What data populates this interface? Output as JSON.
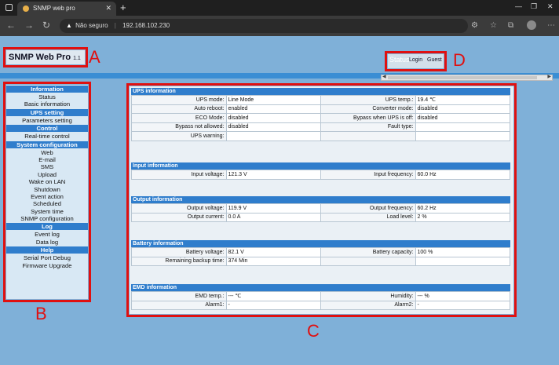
{
  "browser": {
    "tab_title": "SNMP web pro",
    "security_label": "Não seguro",
    "url": "192.168.102.230"
  },
  "brand": {
    "name": "SNMP Web Pro",
    "version": "1.1"
  },
  "status_area": {
    "status": "Status",
    "login": "Login",
    "guest": "Guest"
  },
  "annotations": {
    "a": "A",
    "b": "B",
    "c": "C",
    "d": "D"
  },
  "sidebar": [
    {
      "header": "Information",
      "items": [
        "Status",
        "Basic information"
      ]
    },
    {
      "header": "UPS setting",
      "items": [
        "Parameters setting"
      ]
    },
    {
      "header": "Control",
      "items": [
        "Real-time control"
      ]
    },
    {
      "header": "System configuration",
      "items": [
        "Web",
        "E-mail",
        "SMS",
        "Upload",
        "Wake on LAN",
        "Shutdown",
        "Event action",
        "Scheduled",
        "System time",
        "SNMP configuration"
      ]
    },
    {
      "header": "Log",
      "items": [
        "Event log",
        "Data log"
      ]
    },
    {
      "header": "Help",
      "items": [
        "Serial Port Debug",
        "Firmware Upgrade"
      ]
    }
  ],
  "sections": [
    {
      "title": "UPS information",
      "rows": [
        [
          "UPS mode:",
          "Line Mode",
          "UPS temp.:",
          "19.4 ℃"
        ],
        [
          "Auto reboot:",
          "enabled",
          "Converter mode:",
          "disabled"
        ],
        [
          "ECO Mode:",
          "disabled",
          "Bypass when UPS is off:",
          "disabled"
        ],
        [
          "Bypass not allowed:",
          "disabled",
          "Fault type:",
          ""
        ],
        [
          "UPS warning:",
          "",
          "",
          ""
        ]
      ]
    },
    {
      "title": "Input information",
      "rows": [
        [
          "Input voltage:",
          "121.3 V",
          "Input frequency:",
          "60.0 Hz"
        ]
      ]
    },
    {
      "title": "Output information",
      "rows": [
        [
          "Output voltage:",
          "119.9 V",
          "Output frequency:",
          "60.2 Hz"
        ],
        [
          "Output current:",
          "0.0 A",
          "Load level:",
          "2 %"
        ]
      ]
    },
    {
      "title": "Battery information",
      "rows": [
        [
          "Battery voltage:",
          "82.1 V",
          "Battery capacity:",
          "100 %"
        ],
        [
          "Remaining backup time:",
          "374 Min",
          "",
          ""
        ]
      ]
    },
    {
      "title": "EMD information",
      "rows": [
        [
          "EMD temp.:",
          "--- ℃",
          "Humidity:",
          "--- %"
        ],
        [
          "Alarm1:",
          "-",
          "Alarm2:",
          "-"
        ]
      ]
    }
  ]
}
